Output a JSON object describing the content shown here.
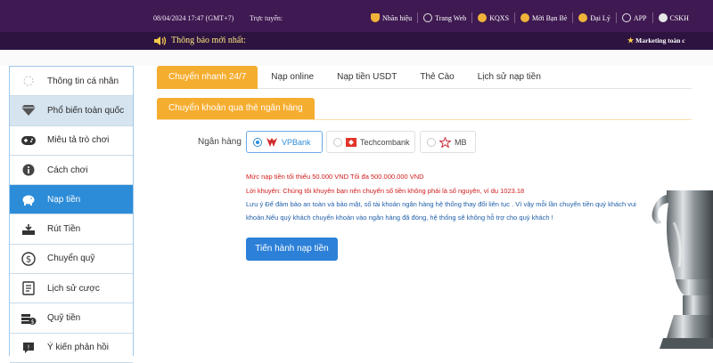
{
  "topbar": {
    "datetime": "08/04/2024 17:47 (GMT+7)",
    "live_label": "Trực tuyến:",
    "nav": [
      {
        "label": "Nhãn hiệu",
        "icon": "trophy-icon",
        "color": "#f0b33a"
      },
      {
        "label": "Trang Web",
        "icon": "globe-icon",
        "color": "#e6e6e6"
      },
      {
        "label": "KQXS",
        "icon": "lottery-icon",
        "color": "#f0b33a"
      },
      {
        "label": "Mời Bạn Bè",
        "icon": "users-icon",
        "color": "#f0b33a"
      },
      {
        "label": "Đại Lý",
        "icon": "heart-icon",
        "color": "#f0b33a"
      },
      {
        "label": "APP",
        "icon": "app-icon",
        "color": "#e6e6e6"
      },
      {
        "label": "CSKH",
        "icon": "headset-icon",
        "color": "#e6e6e6"
      }
    ]
  },
  "notice": {
    "label": "Thông báo mới nhất:",
    "marquee": "Marketing toàn c"
  },
  "sidebar": {
    "items": [
      {
        "label": "Thông tin cá nhân",
        "icon": "profile-icon"
      },
      {
        "label": "Phổ biến toàn quốc",
        "icon": "diamond-icon"
      },
      {
        "label": "Miêu tả trò chơi",
        "icon": "gamepad-icon"
      },
      {
        "label": "Cách chơi",
        "icon": "info-icon"
      },
      {
        "label": "Nạp tiền",
        "icon": "piggy-bank-icon"
      },
      {
        "label": "Rút Tiền",
        "icon": "withdraw-icon"
      },
      {
        "label": "Chuyển quỹ",
        "icon": "dollar-circle-icon"
      },
      {
        "label": "Lịch sử cược",
        "icon": "history-icon"
      },
      {
        "label": "Quỹ tiền",
        "icon": "coins-icon"
      },
      {
        "label": "Ý kiến phản hồi",
        "icon": "feedback-icon"
      }
    ]
  },
  "tabs": [
    "Chuyển nhanh 24/7",
    "Nạp online",
    "Nạp tiền USDT",
    "Thẻ Cào",
    "Lịch sử nạp tiền"
  ],
  "subtab": "Chuyển khoản qua thẻ ngân hàng",
  "bank": {
    "label": "Ngân hàng",
    "options": [
      {
        "name": "VPBank",
        "selected": true
      },
      {
        "name": "Techcombank",
        "selected": false
      },
      {
        "name": "MB",
        "selected": false
      }
    ]
  },
  "notes": {
    "limit": "Mức nạp tiền tối thiểu 50.000 VND Tối đa 500.000.000 VND",
    "advice": "Lời khuyên: Chúng tôi khuyên bạn nên chuyển số tiền không phải là số nguyên, ví dụ 1023.18",
    "caution_1": "Lưu ý   Để đảm bảo an toàn và bảo mật, số tài khoản ngân hàng hệ thống thay đổi liên tục . Vì vậy mỗi lần chuyển tiền quý khách vui",
    "caution_2": "khoản.Nếu quý khách chuyển khoản vào ngân hàng đã đóng, hệ thống sẽ không hỗ trợ cho quý khách !"
  },
  "submit_label": "Tiến hành nạp tiền",
  "colors": {
    "topbar": "#3f1a52",
    "accent_orange": "#f5ad2f",
    "accent_blue": "#2c8cd8",
    "warning_red": "#d11b1b"
  }
}
